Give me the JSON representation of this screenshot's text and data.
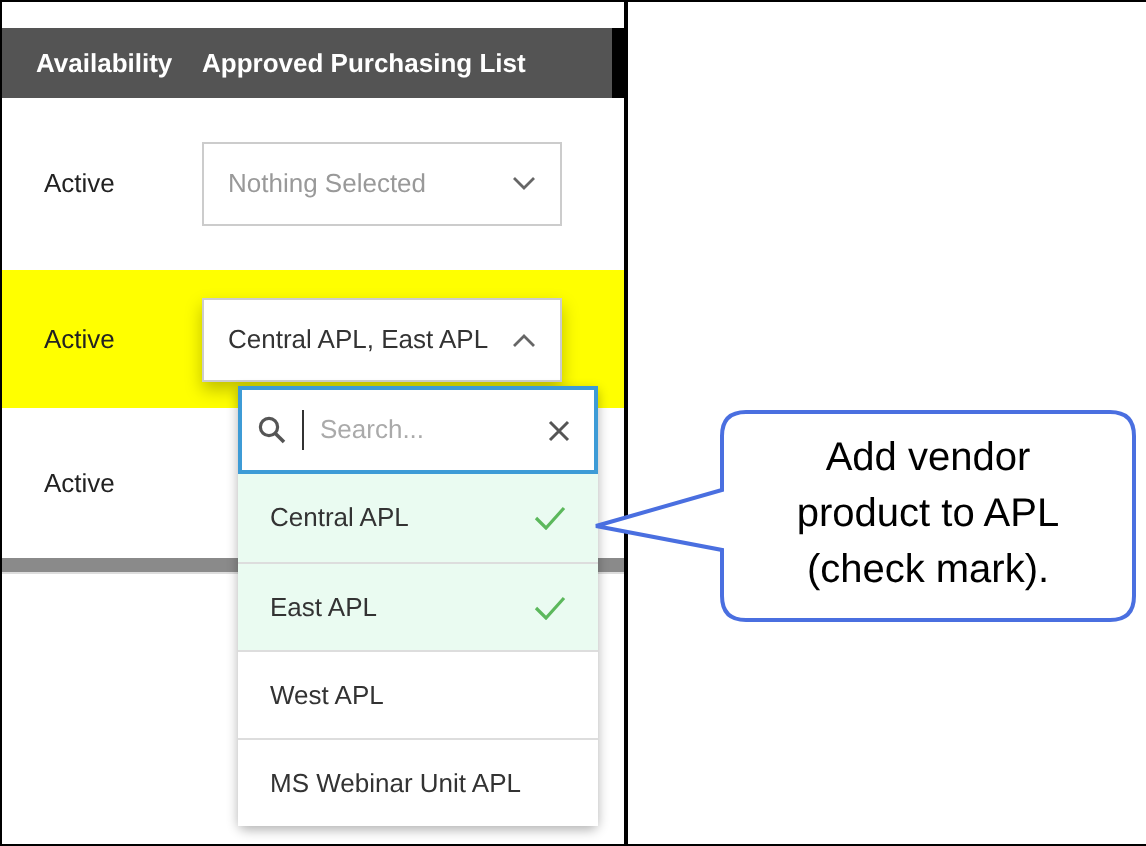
{
  "table": {
    "columns": [
      "Availability",
      "Approved Purchasing List"
    ],
    "rows": [
      {
        "availability": "Active",
        "highlighted": false,
        "apl_select": {
          "placeholder": "Nothing Selected",
          "open": false
        }
      },
      {
        "availability": "Active",
        "highlighted": true,
        "apl_select": {
          "value": "Central APL, East APL",
          "open": true
        }
      },
      {
        "availability": "Active",
        "highlighted": false
      }
    ]
  },
  "dropdown": {
    "search": {
      "placeholder": "Search..."
    },
    "options": [
      {
        "label": "Central APL",
        "selected": true
      },
      {
        "label": "East APL",
        "selected": true
      },
      {
        "label": "West APL",
        "selected": false
      },
      {
        "label": "MS Webinar Unit APL",
        "selected": false
      }
    ]
  },
  "callout": {
    "text": "Add vendor product to APL (check mark)."
  }
}
